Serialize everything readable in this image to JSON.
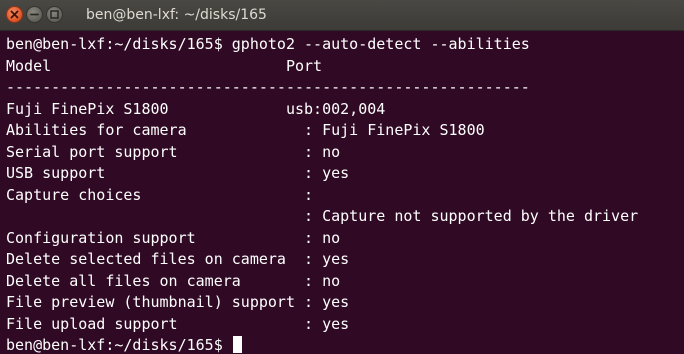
{
  "window": {
    "title": "ben@ben-lxf: ~/disks/165"
  },
  "terminal": {
    "lines": [
      "ben@ben-lxf:~/disks/165$ gphoto2 --auto-detect --abilities",
      "Model                          Port",
      "----------------------------------------------------------",
      "Fuji FinePix S1800             usb:002,004",
      "Abilities for camera             : Fuji FinePix S1800",
      "Serial port support              : no",
      "USB support                      : yes",
      "Capture choices                  :",
      "                                 : Capture not supported by the driver",
      "Configuration support            : no",
      "Delete selected files on camera  : yes",
      "Delete all files on camera       : no",
      "File preview (thumbnail) support : yes",
      "File upload support              : yes"
    ],
    "prompt": "ben@ben-lxf:~/disks/165$ "
  },
  "colors": {
    "background": "#300a24",
    "text": "#ffffff",
    "titlebar": "#3c3b37",
    "close_button": "#e0562a"
  },
  "icons": [
    "close-icon",
    "minimize-icon",
    "maximize-icon"
  ]
}
